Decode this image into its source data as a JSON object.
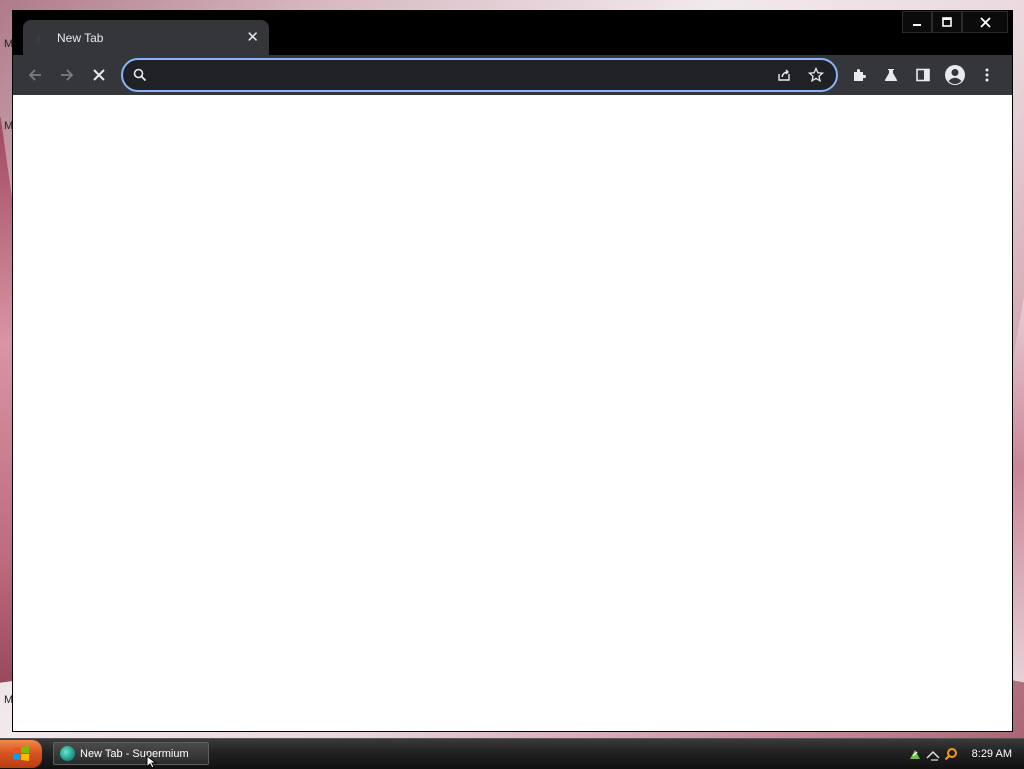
{
  "desktop": {
    "letters": [
      "M",
      "M",
      "M"
    ]
  },
  "browser": {
    "tab": {
      "title": "New Tab",
      "close_glyph": "✕"
    },
    "window_controls": {
      "minimize": "—",
      "maximize": "☐",
      "close": "✕"
    },
    "toolbar": {
      "back_icon": "arrow-left-icon",
      "forward_icon": "arrow-right-icon",
      "stop_icon": "close-icon",
      "omnibox": {
        "value": "",
        "placeholder": ""
      },
      "omnibox_icons": [
        "search-icon",
        "share-icon",
        "star-icon"
      ],
      "right_icons": [
        "extensions-icon",
        "labs-icon",
        "side-panel-icon",
        "profile-icon",
        "more-icon"
      ]
    },
    "accent_color": "#8ab4f8",
    "frame_color": "#35363a"
  },
  "taskbar": {
    "task_label": "New Tab - Supermium",
    "clock": "8:29 AM",
    "start_color": "#d8541f"
  }
}
